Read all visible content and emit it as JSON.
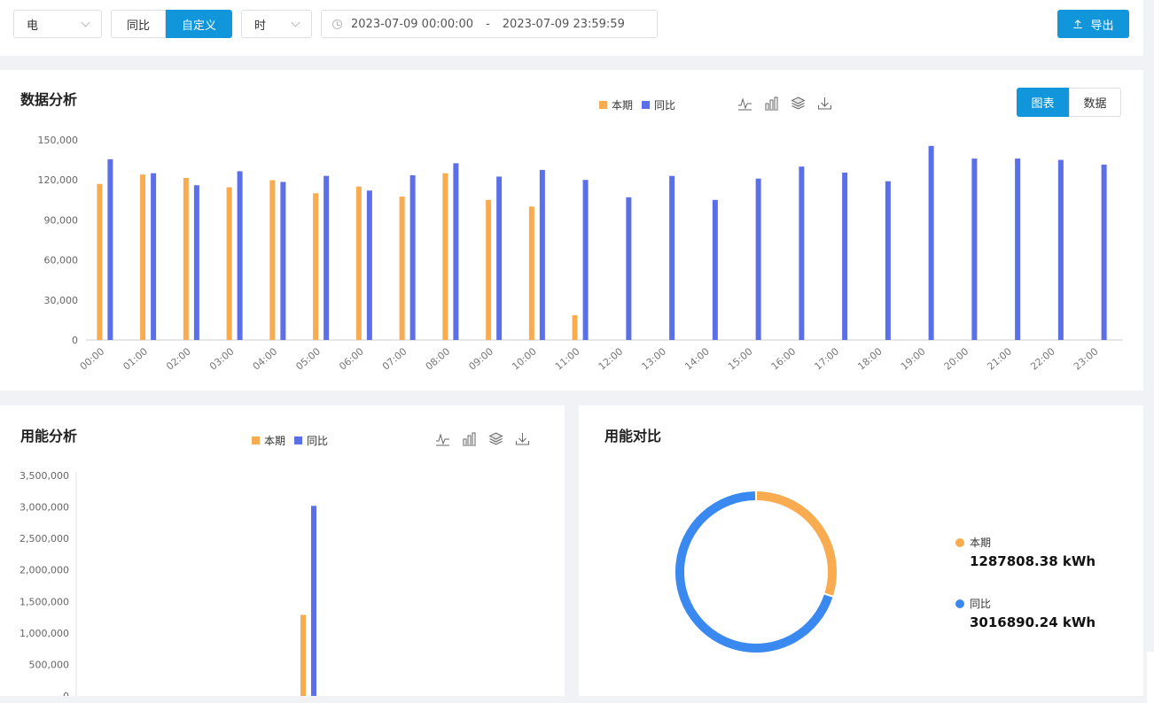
{
  "toolbar": {
    "energy_select": "电",
    "compare_tabs": [
      {
        "label": "同比",
        "active": false
      },
      {
        "label": "自定义",
        "active": true
      }
    ],
    "granularity_select": "时",
    "date_start": "2023-07-09 00:00:00",
    "date_sep": "-",
    "date_end": "2023-07-09 23:59:59",
    "export_label": "导出",
    "accent_color": "#1296db"
  },
  "analysis": {
    "title": "数据分析",
    "legend": [
      "本期",
      "同比"
    ],
    "tool_icons": [
      "line-chart-icon",
      "bar-chart-icon",
      "stack-icon",
      "download-icon"
    ],
    "view_tabs": [
      {
        "label": "图表",
        "active": true
      },
      {
        "label": "数据",
        "active": false
      }
    ]
  },
  "usage": {
    "title": "用能分析",
    "legend": [
      "本期",
      "同比"
    ],
    "tool_icons": [
      "line-chart-icon",
      "bar-chart-icon",
      "stack-icon",
      "download-icon"
    ]
  },
  "compare": {
    "title": "用能对比",
    "items": [
      {
        "name": "本期",
        "value": "1287808.38 kWh",
        "color": "#f9ab4f"
      },
      {
        "name": "同比",
        "value": "3016890.24 kWh",
        "color": "#3a89f0"
      }
    ]
  },
  "chart_data": [
    {
      "type": "bar",
      "categories": [
        "00:00",
        "01:00",
        "02:00",
        "03:00",
        "04:00",
        "05:00",
        "06:00",
        "07:00",
        "08:00",
        "09:00",
        "10:00",
        "11:00",
        "12:00",
        "13:00",
        "14:00",
        "15:00",
        "16:00",
        "17:00",
        "18:00",
        "19:00",
        "20:00",
        "21:00",
        "22:00",
        "23:00"
      ],
      "series": [
        {
          "name": "本期",
          "color": "#f9ab4f",
          "values": [
            117000,
            124000,
            121500,
            114500,
            119800,
            110000,
            115000,
            107500,
            125000,
            105000,
            100000,
            18500,
            null,
            null,
            null,
            null,
            null,
            null,
            null,
            null,
            null,
            null,
            null,
            null
          ]
        },
        {
          "name": "同比",
          "color": "#5b6fe8",
          "values": [
            135500,
            125000,
            116000,
            126500,
            118500,
            123000,
            112000,
            123500,
            132500,
            122500,
            127500,
            120000,
            107000,
            123000,
            105000,
            121000,
            130000,
            125500,
            119000,
            145500,
            136000,
            136000,
            135000,
            131500
          ]
        }
      ],
      "yticks": [
        "0",
        "30,000",
        "60,000",
        "90,000",
        "120,000",
        "150,000"
      ],
      "ylim": [
        0,
        150000
      ],
      "grid": false
    },
    {
      "type": "bar",
      "categories": [
        ""
      ],
      "series": [
        {
          "name": "本期",
          "color": "#f9ab4f",
          "values": [
            1287808.38
          ]
        },
        {
          "name": "同比",
          "color": "#5b6fe8",
          "values": [
            3016890.24
          ]
        }
      ],
      "yticks": [
        "0",
        "500,000",
        "1,000,000",
        "1,500,000",
        "2,000,000",
        "2,500,000",
        "3,000,000",
        "3,500,000"
      ],
      "ylim": [
        0,
        3500000
      ],
      "grid": false
    },
    {
      "type": "pie",
      "style": "donut",
      "labels": [
        "本期",
        "同比"
      ],
      "values": [
        1287808.38,
        3016890.24
      ],
      "colors": [
        "#f9ab4f",
        "#3a89f0"
      ]
    }
  ]
}
